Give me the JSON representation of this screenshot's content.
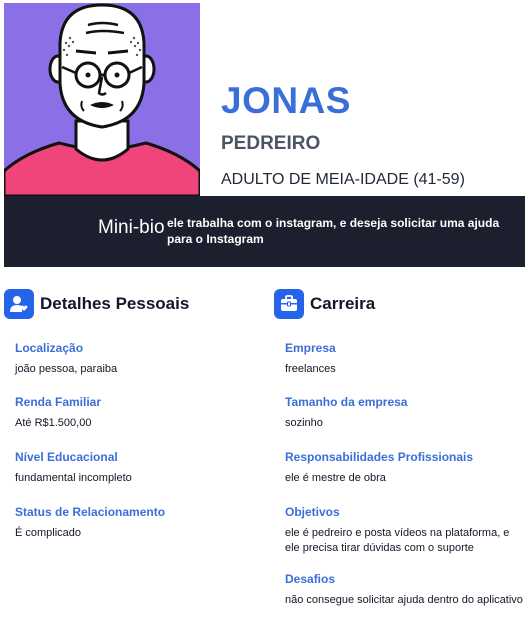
{
  "persona": {
    "name": "JONAS",
    "role": "PEDREIRO",
    "age_group": "ADULTO DE MEIA-IDADE (41-59)"
  },
  "mini_bio": {
    "title": "Mini-bio",
    "text": "ele trabalha com o instagram, e deseja solicitar uma ajuda para o Instagram"
  },
  "personal": {
    "title": "Detalhes Pessoais",
    "icon": "user-heart-icon",
    "fields": [
      {
        "label": "Localização",
        "value": "joão pessoa, paraiba"
      },
      {
        "label": "Renda Familiar",
        "value": "Até R$1.500,00"
      },
      {
        "label": "Nível Educacional",
        "value": "fundamental incompleto"
      },
      {
        "label": "Status de Relacionamento",
        "value": "É complicado"
      }
    ]
  },
  "career": {
    "title": "Carreira",
    "icon": "briefcase-icon",
    "fields": [
      {
        "label": "Empresa",
        "value": "freelances"
      },
      {
        "label": "Tamanho da empresa",
        "value": "sozinho"
      },
      {
        "label": "Responsabilidades Profissionais",
        "value": "ele é mestre de obra"
      },
      {
        "label": "Objetivos",
        "value": "ele é pedreiro e posta vídeos na plataforma, e ele precisa tirar dúvidas com o suporte"
      },
      {
        "label": "Desafios",
        "value": "não consegue solicitar ajuda dentro do aplicativo"
      }
    ]
  },
  "colors": {
    "accent": "#3b6fd8",
    "avatar_bg": "#8b6fe6",
    "band_bg": "#1b1f2e",
    "shirt": "#f0457a"
  }
}
